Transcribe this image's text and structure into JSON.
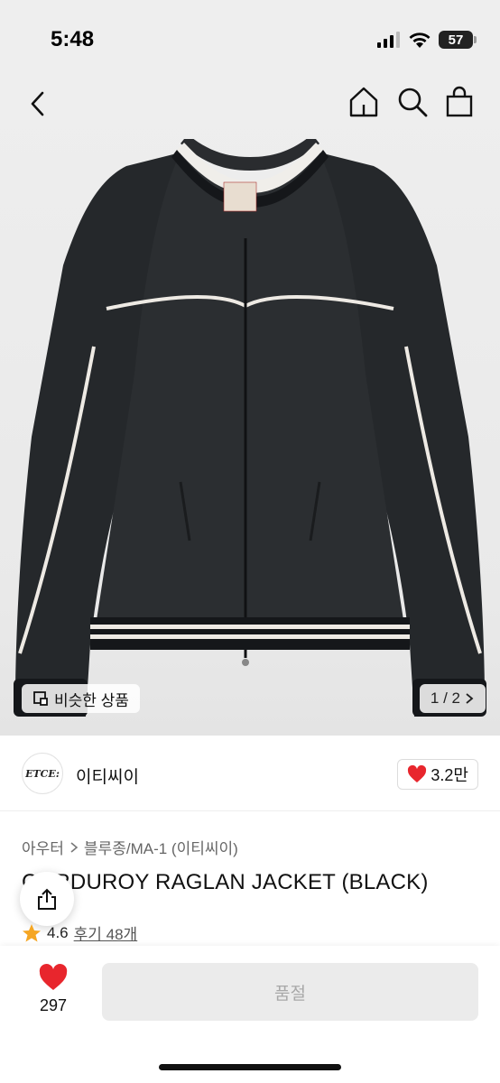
{
  "status_bar": {
    "time": "5:48",
    "battery": "57",
    "icons": [
      "signal-icon",
      "wifi-icon",
      "battery-icon"
    ]
  },
  "nav": {
    "icons": [
      "back-icon",
      "home-icon",
      "search-icon",
      "shopping-bag-icon"
    ]
  },
  "gallery": {
    "similar_label": "비슷한 상품",
    "page_indicator": "1 / 2",
    "current_page": 1,
    "total_pages": 2
  },
  "brand": {
    "logo_text": "ETCE:",
    "name": "이티씨이",
    "likes": "3.2만"
  },
  "product": {
    "breadcrumb_parent": "아우터",
    "breadcrumb_child": "블루종/MA-1 (이티씨이)",
    "title": "CORDUROY RAGLAN JACKET (BLACK)",
    "rating": "4.6",
    "reviews": "후기 48개"
  },
  "bottom_bar": {
    "like_count": "297",
    "buy_label": "품절"
  },
  "colors": {
    "accent_red": "#e8262d",
    "star_orange": "#f5a623",
    "disabled_button": "#ebebeb"
  }
}
